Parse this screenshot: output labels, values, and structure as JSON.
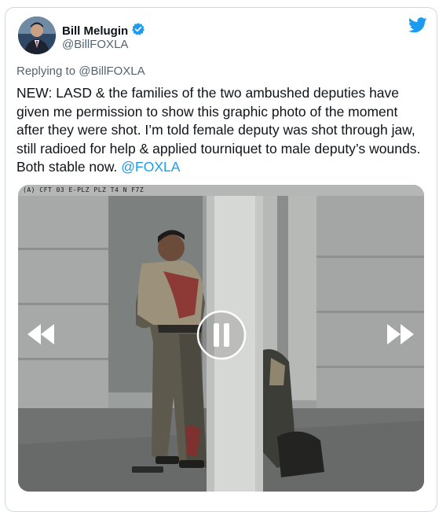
{
  "tweet": {
    "author_name": "Bill Melugin",
    "author_handle": "@BillFOXLA",
    "verified": true,
    "reply_prefix": "Replying to ",
    "reply_to": "@BillFOXLA",
    "body_text": "NEW: LASD & the families of the two ambushed deputies have given me permission to show this graphic photo of the moment after they were shot. I’m told female deputy was shot through jaw, still radioed for help & applied tourniquet to male deputy’s wounds. Both stable now. ",
    "body_mention": "@FOXLA"
  },
  "media": {
    "timestamp_overlay": "(A) CFT 03 E-PLZ PLZ T4 N F7Z",
    "controls": {
      "rewind": "rewind-icon",
      "pause": "pause-icon",
      "fast_forward": "fast-forward-icon"
    }
  },
  "icons": {
    "brand": "twitter-bird-icon",
    "verified": "verified-badge-icon"
  },
  "colors": {
    "accent": "#1d9bf0",
    "text": "#0f1419",
    "secondary_text": "#536471",
    "border": "#cfd9de"
  }
}
